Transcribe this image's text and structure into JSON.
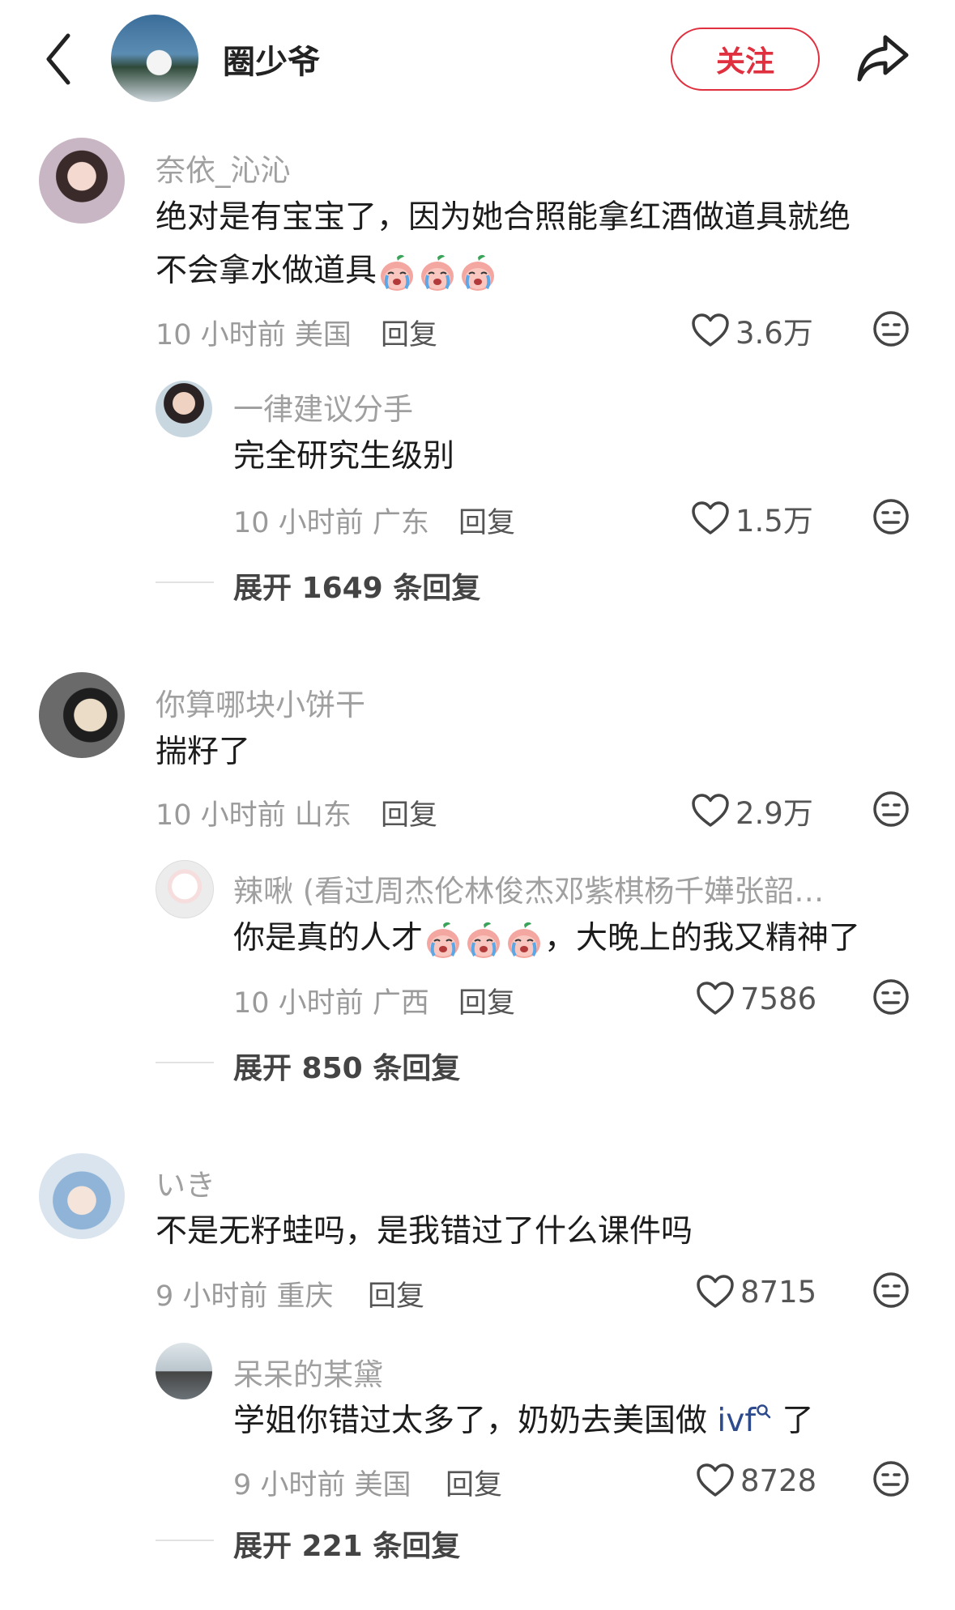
{
  "header": {
    "title": "圈少爷",
    "follow_label": "关注"
  },
  "comments": [
    {
      "name": "奈依_沁沁",
      "text_line1": "绝对是有宝宝了，因为她合照能拿红酒做道具就绝",
      "text_line2": "不会拿水做道具",
      "time": "10 小时前",
      "location": "美国",
      "reply_label": "回复",
      "likes": "3.6万",
      "reply": {
        "name": "一律建议分手",
        "text": "完全研究生级别",
        "time": "10 小时前",
        "location": "广东",
        "reply_label": "回复",
        "likes": "1.5万"
      },
      "expand": "展开 1649 条回复"
    },
    {
      "name": "你算哪块小饼干",
      "text": "揣籽了",
      "time": "10 小时前",
      "location": "山东",
      "reply_label": "回复",
      "likes": "2.9万",
      "reply": {
        "name": "辣啾 (看过周杰伦林俊杰邓紫棋杨千嬅张韶…",
        "text_a": "你是真的人才",
        "text_b": "，大晚上的我又精神了",
        "time": "10 小时前",
        "location": "广西",
        "reply_label": "回复",
        "likes": "7586"
      },
      "expand": "展开 850 条回复"
    },
    {
      "name": "いき",
      "text": "不是无籽蛙吗，是我错过了什么课件吗",
      "time": "9 小时前",
      "location": "重庆",
      "reply_label": "回复",
      "likes": "8715",
      "reply": {
        "name": "呆呆的某黛",
        "text_a": "学姐你错过太多了，奶奶去美国做 ",
        "link": "ivf",
        "text_b": " 了",
        "time": "9 小时前",
        "location": "美国",
        "reply_label": "回复",
        "likes": "8728"
      },
      "expand": "展开 221 条回复"
    }
  ],
  "icons": {
    "back": "chevron-left-icon",
    "share": "share-arrow-icon",
    "like": "heart-outline-icon",
    "dislike": "meh-face-icon",
    "emoji": "crying-peach-emoji",
    "search": "search-icon"
  },
  "colors": {
    "accent": "#e0303f",
    "link": "#2c4a8c"
  }
}
